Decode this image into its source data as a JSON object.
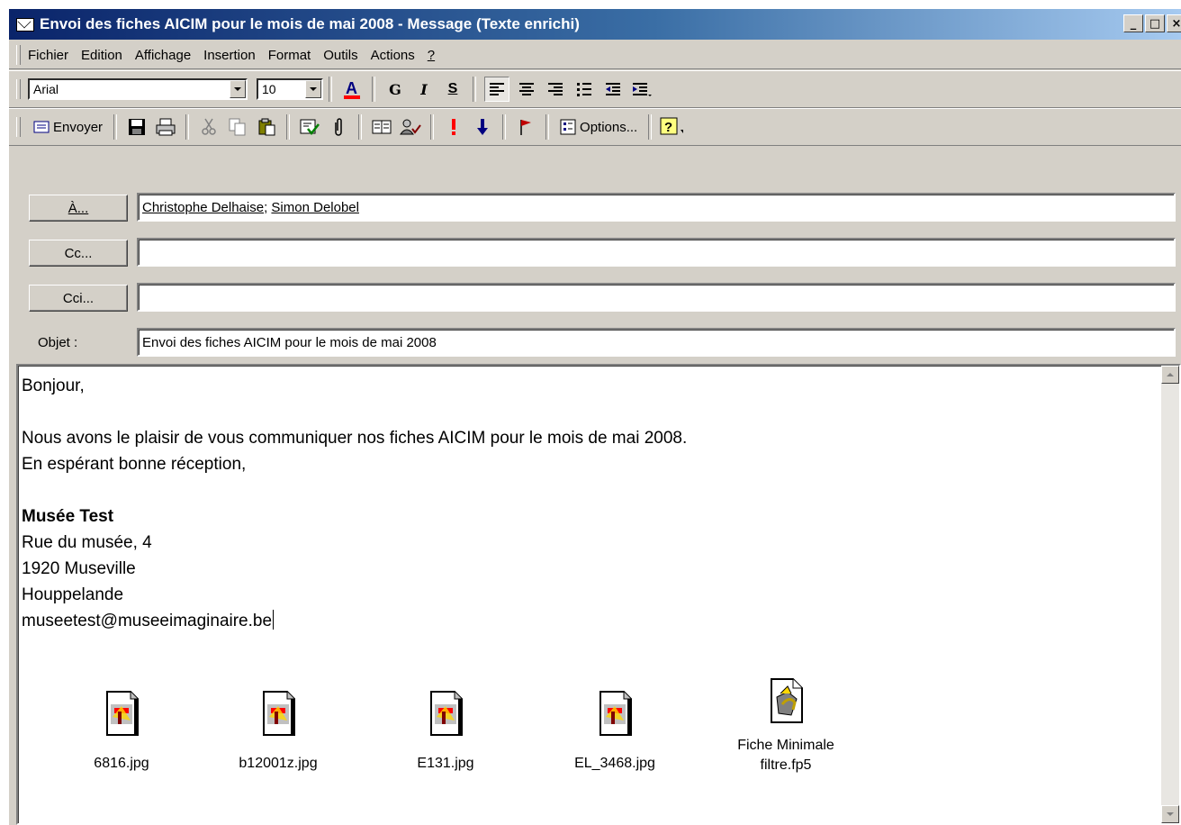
{
  "window": {
    "title": "Envoi des fiches AICIM pour le mois de mai 2008 - Message (Texte enrichi)",
    "buttons": [
      "_",
      "□",
      "×"
    ]
  },
  "menubar": {
    "items": [
      "Fichier",
      "Edition",
      "Affichage",
      "Insertion",
      "Format",
      "Outils",
      "Actions",
      "?"
    ]
  },
  "format_toolbar": {
    "font": "Arial",
    "size": "10",
    "bold": "G",
    "italic": "I",
    "underline": "S"
  },
  "standard_toolbar": {
    "send_label": "Envoyer",
    "options_label": "Options..."
  },
  "header": {
    "to_label": "À...",
    "to_recipients": [
      "Christophe Delhaise",
      "Simon Delobel"
    ],
    "to_separator": "; ",
    "cc_label": "Cc...",
    "cc_value": "",
    "bcc_label": "Cci...",
    "bcc_value": "",
    "subject_label": "Objet :",
    "subject_value": "Envoi des fiches AICIM pour le mois de mai 2008"
  },
  "message": {
    "greeting": "Bonjour,",
    "line1": "Nous avons le plaisir de vous communiquer nos fiches AICIM pour le mois de mai 2008.",
    "line2": "En espérant bonne réception,",
    "sig_name": "Musée Test",
    "sig_street": "Rue du musée, 4",
    "sig_city": "1920 Museville",
    "sig_region": "Houppelande",
    "sig_email": "museetest@museeimaginaire.be"
  },
  "attachments": [
    {
      "name": "6816.jpg",
      "icon": "jpg-file-icon"
    },
    {
      "name": "b12001z.jpg",
      "icon": "jpg-file-icon"
    },
    {
      "name": "E131.jpg",
      "icon": "jpg-file-icon"
    },
    {
      "name": "EL_3468.jpg",
      "icon": "jpg-file-icon"
    },
    {
      "name_line1": "Fiche Minimale",
      "name_line2": "filtre.fp5",
      "icon": "filemaker-file-icon"
    }
  ],
  "colors": {
    "titlebar_start": "#0a246a",
    "titlebar_end": "#a6caf0",
    "chrome": "#d4d0c8",
    "font_color_bar": "#ff0000"
  }
}
